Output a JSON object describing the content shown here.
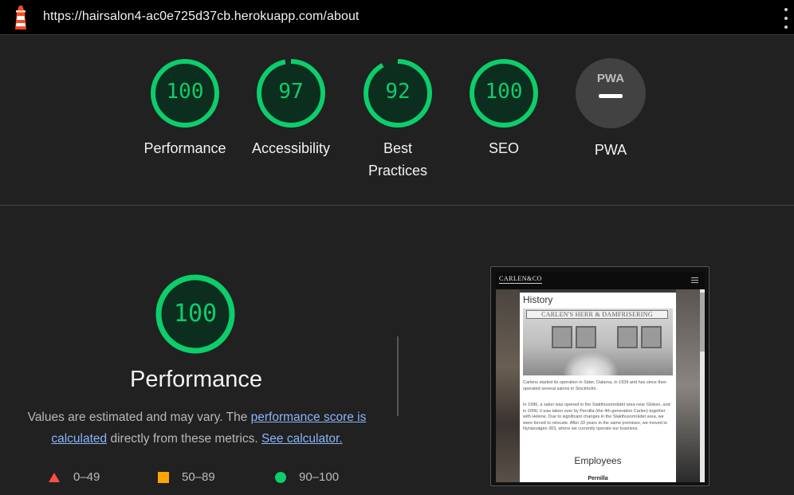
{
  "topbar": {
    "url": "https://hairsalon4-ac0e725d37cb.herokuapp.com/about",
    "logo_icon": "lighthouse-icon",
    "menu_icon": "kebab-menu-icon"
  },
  "summary": [
    {
      "label": "Performance",
      "score": "100",
      "value": 100
    },
    {
      "label": "Accessibility",
      "score": "97",
      "value": 97
    },
    {
      "label": "Best\nPractices",
      "label_line1": "Best",
      "label_line2": "Practices",
      "score": "92",
      "value": 92
    },
    {
      "label": "SEO",
      "score": "100",
      "value": 100
    }
  ],
  "pwa": {
    "label": "PWA",
    "badge_text": "PWA"
  },
  "category": {
    "score": "100",
    "value": 100,
    "title": "Performance",
    "desc_prefix": "Values are estimated and may vary. The ",
    "link1": "performance score is calculated",
    "desc_middle": " directly from these metrics. ",
    "link2": "See calculator."
  },
  "legend": [
    {
      "range": "0–49",
      "shape": "triangle",
      "color": "#ff4e42"
    },
    {
      "range": "50–89",
      "shape": "square",
      "color": "#ffa400"
    },
    {
      "range": "90–100",
      "shape": "circle",
      "color": "#0cce6b"
    }
  ],
  "colors": {
    "pass": "#0cce6b",
    "pass_bg": "#0c2e1e"
  },
  "screenshot": {
    "logo": "CARLEN&CO",
    "heading": "History",
    "sign": "CARLEN'S HERR & DAMFRISERING",
    "para1": "Carlens started its operation in Säter, Dalarna, in 1939 and has since then operated several salons in Stockholm.",
    "para2": "In 1986, a salon was opened in the Slakthusområdet area near Globen, and in 2006, it was taken over by Pernilla (the 4th generation Carlen) together with Helene. Due to significant changes in the Slakthusområdet area, we were forced to relocate. After 33 years in the same premises, we moved to Nynäsvägen 303, where we currently operate our business.",
    "employees": "Employees",
    "employee_name": "Pernilla"
  }
}
